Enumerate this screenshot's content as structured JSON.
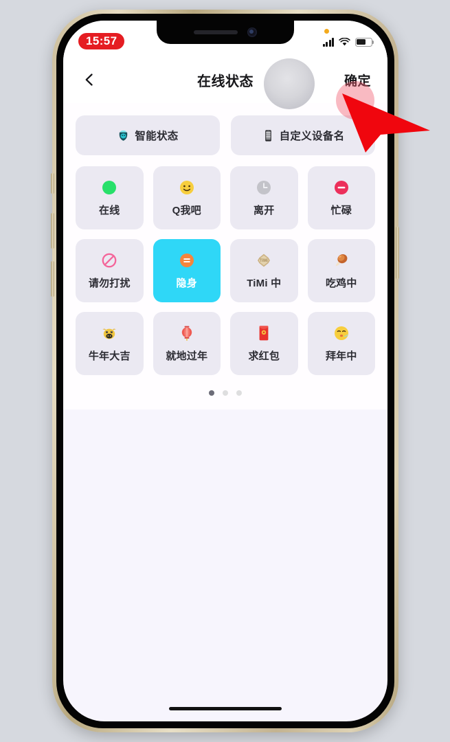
{
  "outer": {
    "background_color": "#d6d9df"
  },
  "device": {
    "frame_color": "#c9ba94",
    "bezel_color": "#040404",
    "screen_background": "#f7f5fd"
  },
  "status_bar": {
    "time": "15:57",
    "time_pill_color": "#e51d22",
    "recording_dot": "orange-dot",
    "signal_icon": "cellular-signal-icon",
    "wifi_icon": "wifi-icon",
    "battery_icon": "battery-icon",
    "battery_level_percent": 60
  },
  "nav_bar": {
    "back_icon": "chevron-left-icon",
    "title": "在线状态",
    "confirm_label": "确定"
  },
  "top_actions": [
    {
      "label": "智能状态",
      "icon": "smart-status-icon"
    },
    {
      "label": "自定义设备名",
      "icon": "device-name-icon"
    }
  ],
  "status_grid": {
    "selected_index": 5,
    "selected_color": "#2fd7f7",
    "tile_color": "#ebe9f2",
    "items": [
      {
        "label": "在线",
        "icon": "green-circle-icon"
      },
      {
        "label": "Q我吧",
        "icon": "smiley-face-icon"
      },
      {
        "label": "离开",
        "icon": "grey-clock-icon"
      },
      {
        "label": "忙碌",
        "icon": "red-minus-circle-icon"
      },
      {
        "label": "请勿打扰",
        "icon": "no-entry-icon"
      },
      {
        "label": "隐身",
        "icon": "orange-equals-circle-icon"
      },
      {
        "label": "TiMi 中",
        "icon": "timi-badge-icon"
      },
      {
        "label": "吃鸡中",
        "icon": "chicken-drumstick-icon"
      },
      {
        "label": "牛年大吉",
        "icon": "ox-face-icon"
      },
      {
        "label": "就地过年",
        "icon": "red-lantern-icon"
      },
      {
        "label": "求红包",
        "icon": "red-envelope-icon"
      },
      {
        "label": "拜年中",
        "icon": "kissing-face-icon"
      }
    ]
  },
  "pagination": {
    "total": 3,
    "active": 1
  },
  "annotation": {
    "arrow_color": "#f0060e",
    "points_at": "确定",
    "tap_halo_color": "rgba(240,90,110,0.42)"
  }
}
